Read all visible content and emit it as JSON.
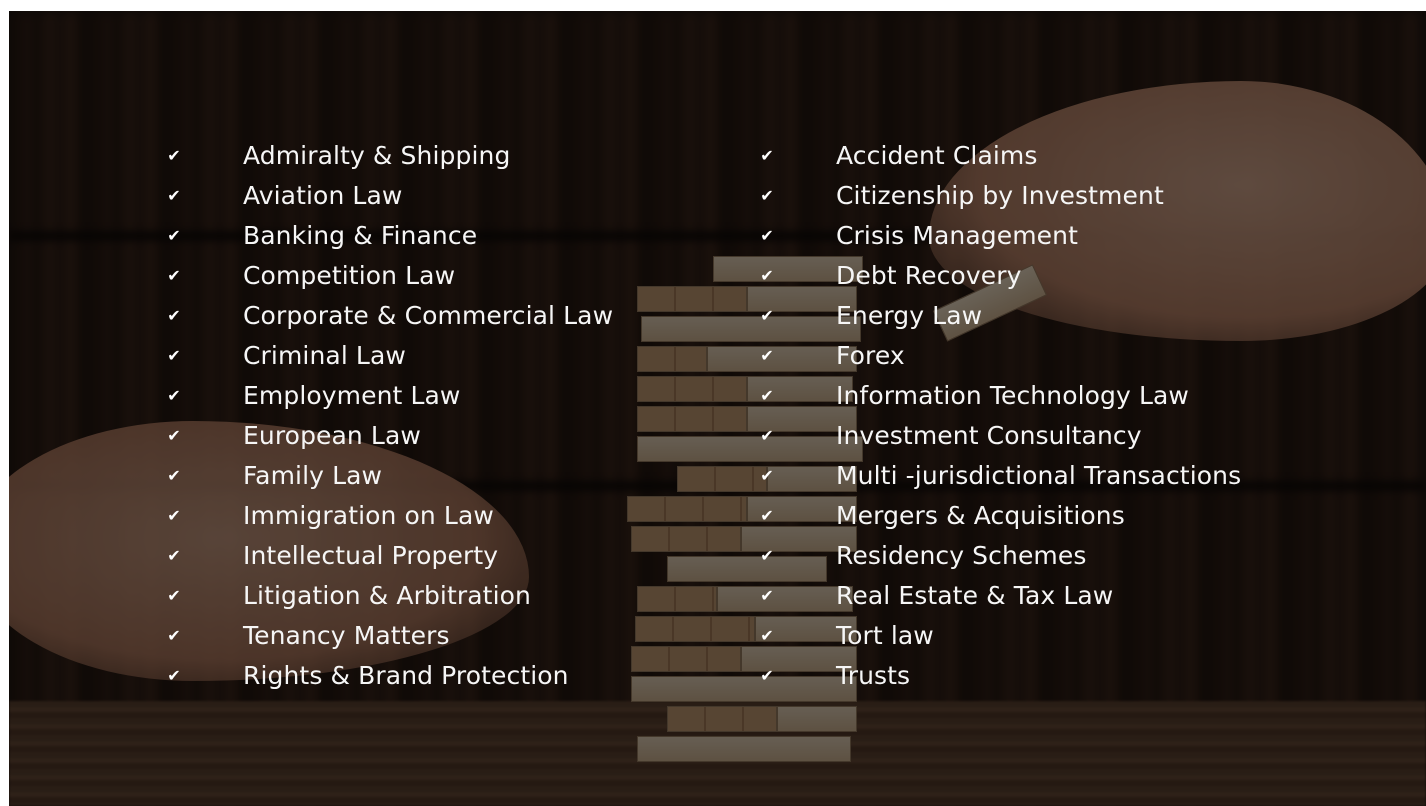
{
  "icons": {
    "check": "✔"
  },
  "colors": {
    "text": "#f6f6f6",
    "overlay": "#000000"
  },
  "practice_areas": {
    "left": [
      {
        "label": "Admiralty & Shipping"
      },
      {
        "label": "Aviation Law"
      },
      {
        "label": "Banking & Finance"
      },
      {
        "label": "Competition Law"
      },
      {
        "label": "Corporate & Commercial Law"
      },
      {
        "label": "Criminal Law"
      },
      {
        "label": "Employment Law"
      },
      {
        "label": "European Law"
      },
      {
        "label": "Family Law"
      },
      {
        "label": "Immigration on Law"
      },
      {
        "label": "Intellectual Property"
      },
      {
        "label": "Litigation & Arbitration"
      },
      {
        "label": "Tenancy Matters"
      },
      {
        "label": "Rights & Brand Protection"
      }
    ],
    "right": [
      {
        "label": "Accident Claims"
      },
      {
        "label": "Citizenship by Investment"
      },
      {
        "label": "Crisis Management"
      },
      {
        "label": "Debt Recovery"
      },
      {
        "label": "Energy Law"
      },
      {
        "label": "Forex"
      },
      {
        "label": "Information Technology Law"
      },
      {
        "label": "Investment Consultancy"
      },
      {
        "label": "Multi -jurisdictional Transactions"
      },
      {
        "label": "Mergers & Acquisitions"
      },
      {
        "label": "Residency Schemes"
      },
      {
        "label": "Real Estate & Tax Law"
      },
      {
        "label": "Tort law"
      },
      {
        "label": "Trusts"
      }
    ]
  }
}
